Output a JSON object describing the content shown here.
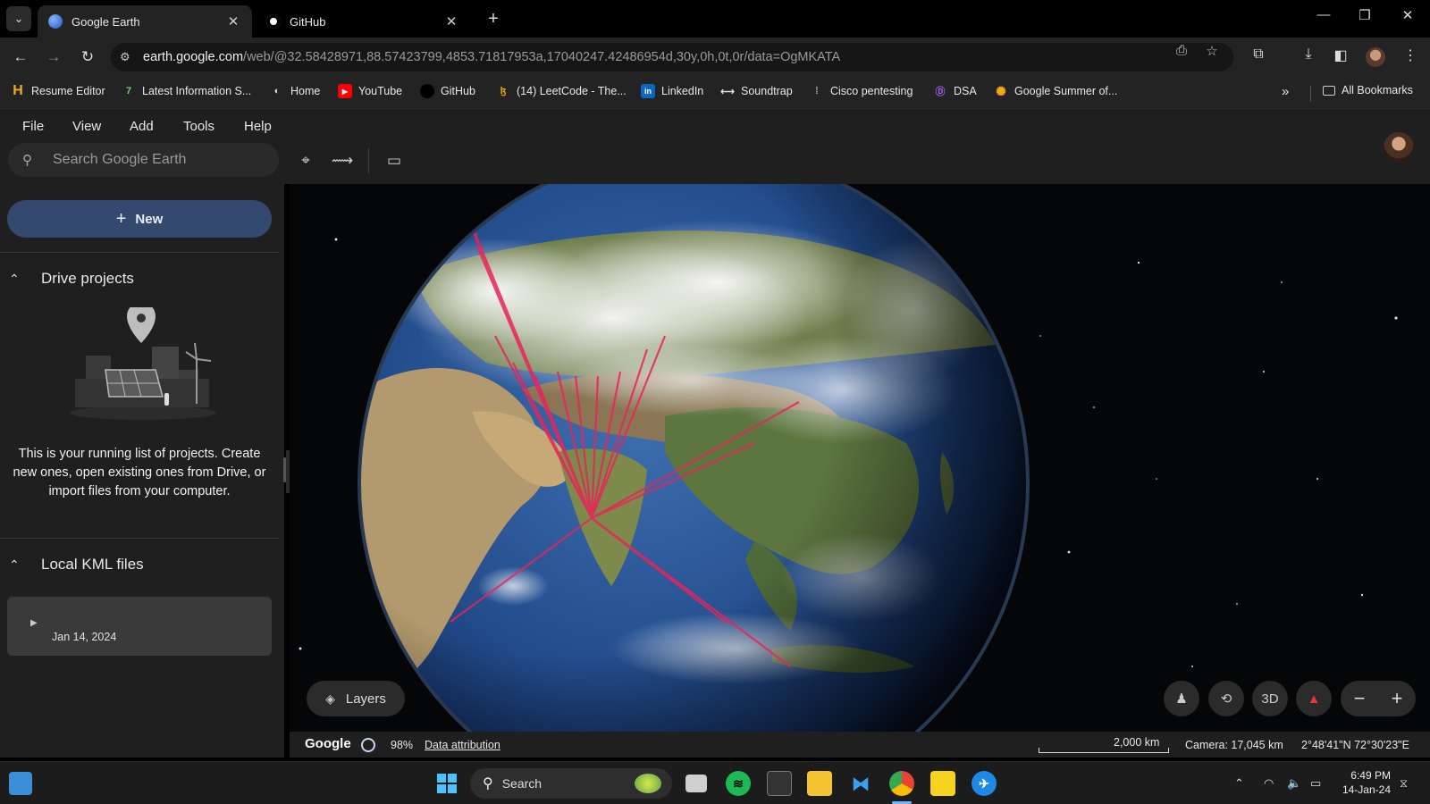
{
  "browser": {
    "tabs": [
      {
        "label": "Google Earth",
        "active": true,
        "close": "✕"
      },
      {
        "label": "GitHub",
        "active": false,
        "close": "✕"
      }
    ],
    "url_host": "earth.google.com",
    "url_path": "/web/@32.58428971,88.57423799,4853.71817953a,17040247.42486954d,30y,0h,0t,0r/data=OgMKATA",
    "bookmarks": [
      {
        "label": "Resume Editor",
        "icon": "H"
      },
      {
        "label": "Latest Information S...",
        "icon": "7"
      },
      {
        "label": "Home",
        "icon": "◐"
      },
      {
        "label": "YouTube",
        "icon": "▶"
      },
      {
        "label": "GitHub",
        "icon": ""
      },
      {
        "label": "(14) LeetCode - The...",
        "icon": "ɮ"
      },
      {
        "label": "LinkedIn",
        "icon": "in"
      },
      {
        "label": "Soundtrap",
        "icon": "⟷"
      },
      {
        "label": "Cisco pentesting",
        "icon": "⁞"
      },
      {
        "label": "DSA",
        "icon": "Ⓓ"
      },
      {
        "label": "Google Summer of...",
        "icon": "✺"
      }
    ],
    "all_bookmarks": "All Bookmarks"
  },
  "earth": {
    "menu": [
      "File",
      "View",
      "Add",
      "Tools",
      "Help"
    ],
    "search_placeholder": "Search Google Earth",
    "new_button": "New",
    "drive_projects": "Drive projects",
    "empty_text": "This is your running list of projects. Create new ones, open existing ones from Drive, or import files from your computer.",
    "local_kml": "Local KML files",
    "kml_item_date": "Jan 14, 2024",
    "layers": "Layers",
    "three_d": "3D",
    "status": {
      "logo": "Google",
      "progress": "98%",
      "attribution": "Data attribution",
      "scale": "2,000 km",
      "camera": "Camera: 17,045 km",
      "coordinates": "2°48'41\"N 72°30'23\"E"
    }
  },
  "taskbar": {
    "search": "Search",
    "time": "6:49 PM",
    "date": "14-Jan-24"
  },
  "colors": {
    "accent_button": "#334a6e",
    "route_lines": "#e8245a",
    "panel_bg": "#1f1f1f"
  }
}
